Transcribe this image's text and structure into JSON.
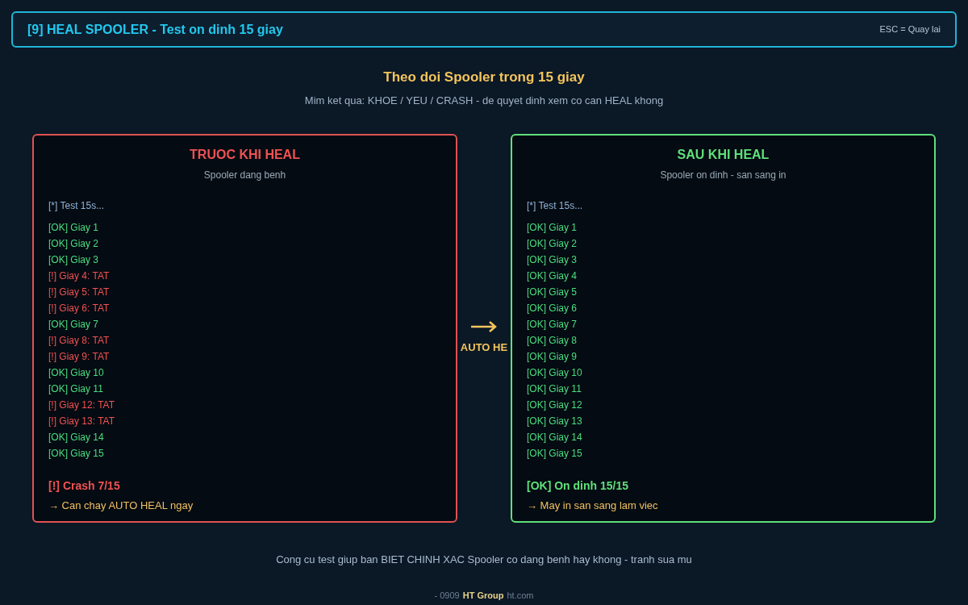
{
  "header": {
    "title": "[9] HEAL SPOOLER - Test on dinh 15 giay",
    "hint": "ESC = Quay lai"
  },
  "intro": {
    "title": "Theo doi Spooler trong 15 giay",
    "subtitle": "Mim ket qua: KHOE / YEU / CRASH - de quyet dinh xem co can HEAL khong"
  },
  "panels": [
    {
      "kind": "bad",
      "title": "TRUOC KHI HEAL",
      "subtitle": "Spooler dang benh",
      "start": "[*] Test 15s...",
      "lines": [
        {
          "kind": "ok",
          "text": "[OK] Giay 1"
        },
        {
          "kind": "ok",
          "text": "[OK] Giay 2"
        },
        {
          "kind": "ok",
          "text": "[OK] Giay 3"
        },
        {
          "kind": "fail",
          "text": "[!] Giay 4: TAT"
        },
        {
          "kind": "fail",
          "text": "[!] Giay 5: TAT"
        },
        {
          "kind": "fail",
          "text": "[!] Giay 6: TAT"
        },
        {
          "kind": "ok",
          "text": "[OK] Giay 7"
        },
        {
          "kind": "fail",
          "text": "[!] Giay 8: TAT"
        },
        {
          "kind": "fail",
          "text": "[!] Giay 9: TAT"
        },
        {
          "kind": "ok",
          "text": "[OK] Giay 10"
        },
        {
          "kind": "ok",
          "text": "[OK] Giay 11"
        },
        {
          "kind": "fail",
          "text": "[!] Giay 12: TAT"
        },
        {
          "kind": "fail",
          "text": "[!] Giay 13: TAT"
        },
        {
          "kind": "ok",
          "text": "[OK] Giay 14"
        },
        {
          "kind": "ok",
          "text": "[OK] Giay 15"
        }
      ],
      "result": "[!] Crash 7/15",
      "advice": "→ Can chay AUTO HEAL ngay"
    },
    {
      "kind": "good",
      "title": "SAU KHI HEAL",
      "subtitle": "Spooler on dinh - san sang in",
      "start": "[*] Test 15s...",
      "lines": [
        {
          "kind": "ok",
          "text": "[OK] Giay 1"
        },
        {
          "kind": "ok",
          "text": "[OK] Giay 2"
        },
        {
          "kind": "ok",
          "text": "[OK] Giay 3"
        },
        {
          "kind": "ok",
          "text": "[OK] Giay 4"
        },
        {
          "kind": "ok",
          "text": "[OK] Giay 5"
        },
        {
          "kind": "ok",
          "text": "[OK] Giay 6"
        },
        {
          "kind": "ok",
          "text": "[OK] Giay 7"
        },
        {
          "kind": "ok",
          "text": "[OK] Giay 8"
        },
        {
          "kind": "ok",
          "text": "[OK] Giay 9"
        },
        {
          "kind": "ok",
          "text": "[OK] Giay 10"
        },
        {
          "kind": "ok",
          "text": "[OK] Giay 11"
        },
        {
          "kind": "ok",
          "text": "[OK] Giay 12"
        },
        {
          "kind": "ok",
          "text": "[OK] Giay 13"
        },
        {
          "kind": "ok",
          "text": "[OK] Giay 14"
        },
        {
          "kind": "ok",
          "text": "[OK] Giay 15"
        }
      ],
      "result": "[OK] On dinh 15/15",
      "advice": "→ May in san sang lam viec"
    }
  ],
  "transition": {
    "label": "AUTO HE"
  },
  "footer": {
    "note": "Cong cu test giup ban BIET CHINH XAC Spooler co dang benh hay khong - tranh sua mu",
    "contact_left": "- 0909",
    "brand": "HT Group",
    "contact_right": "ht.com"
  }
}
